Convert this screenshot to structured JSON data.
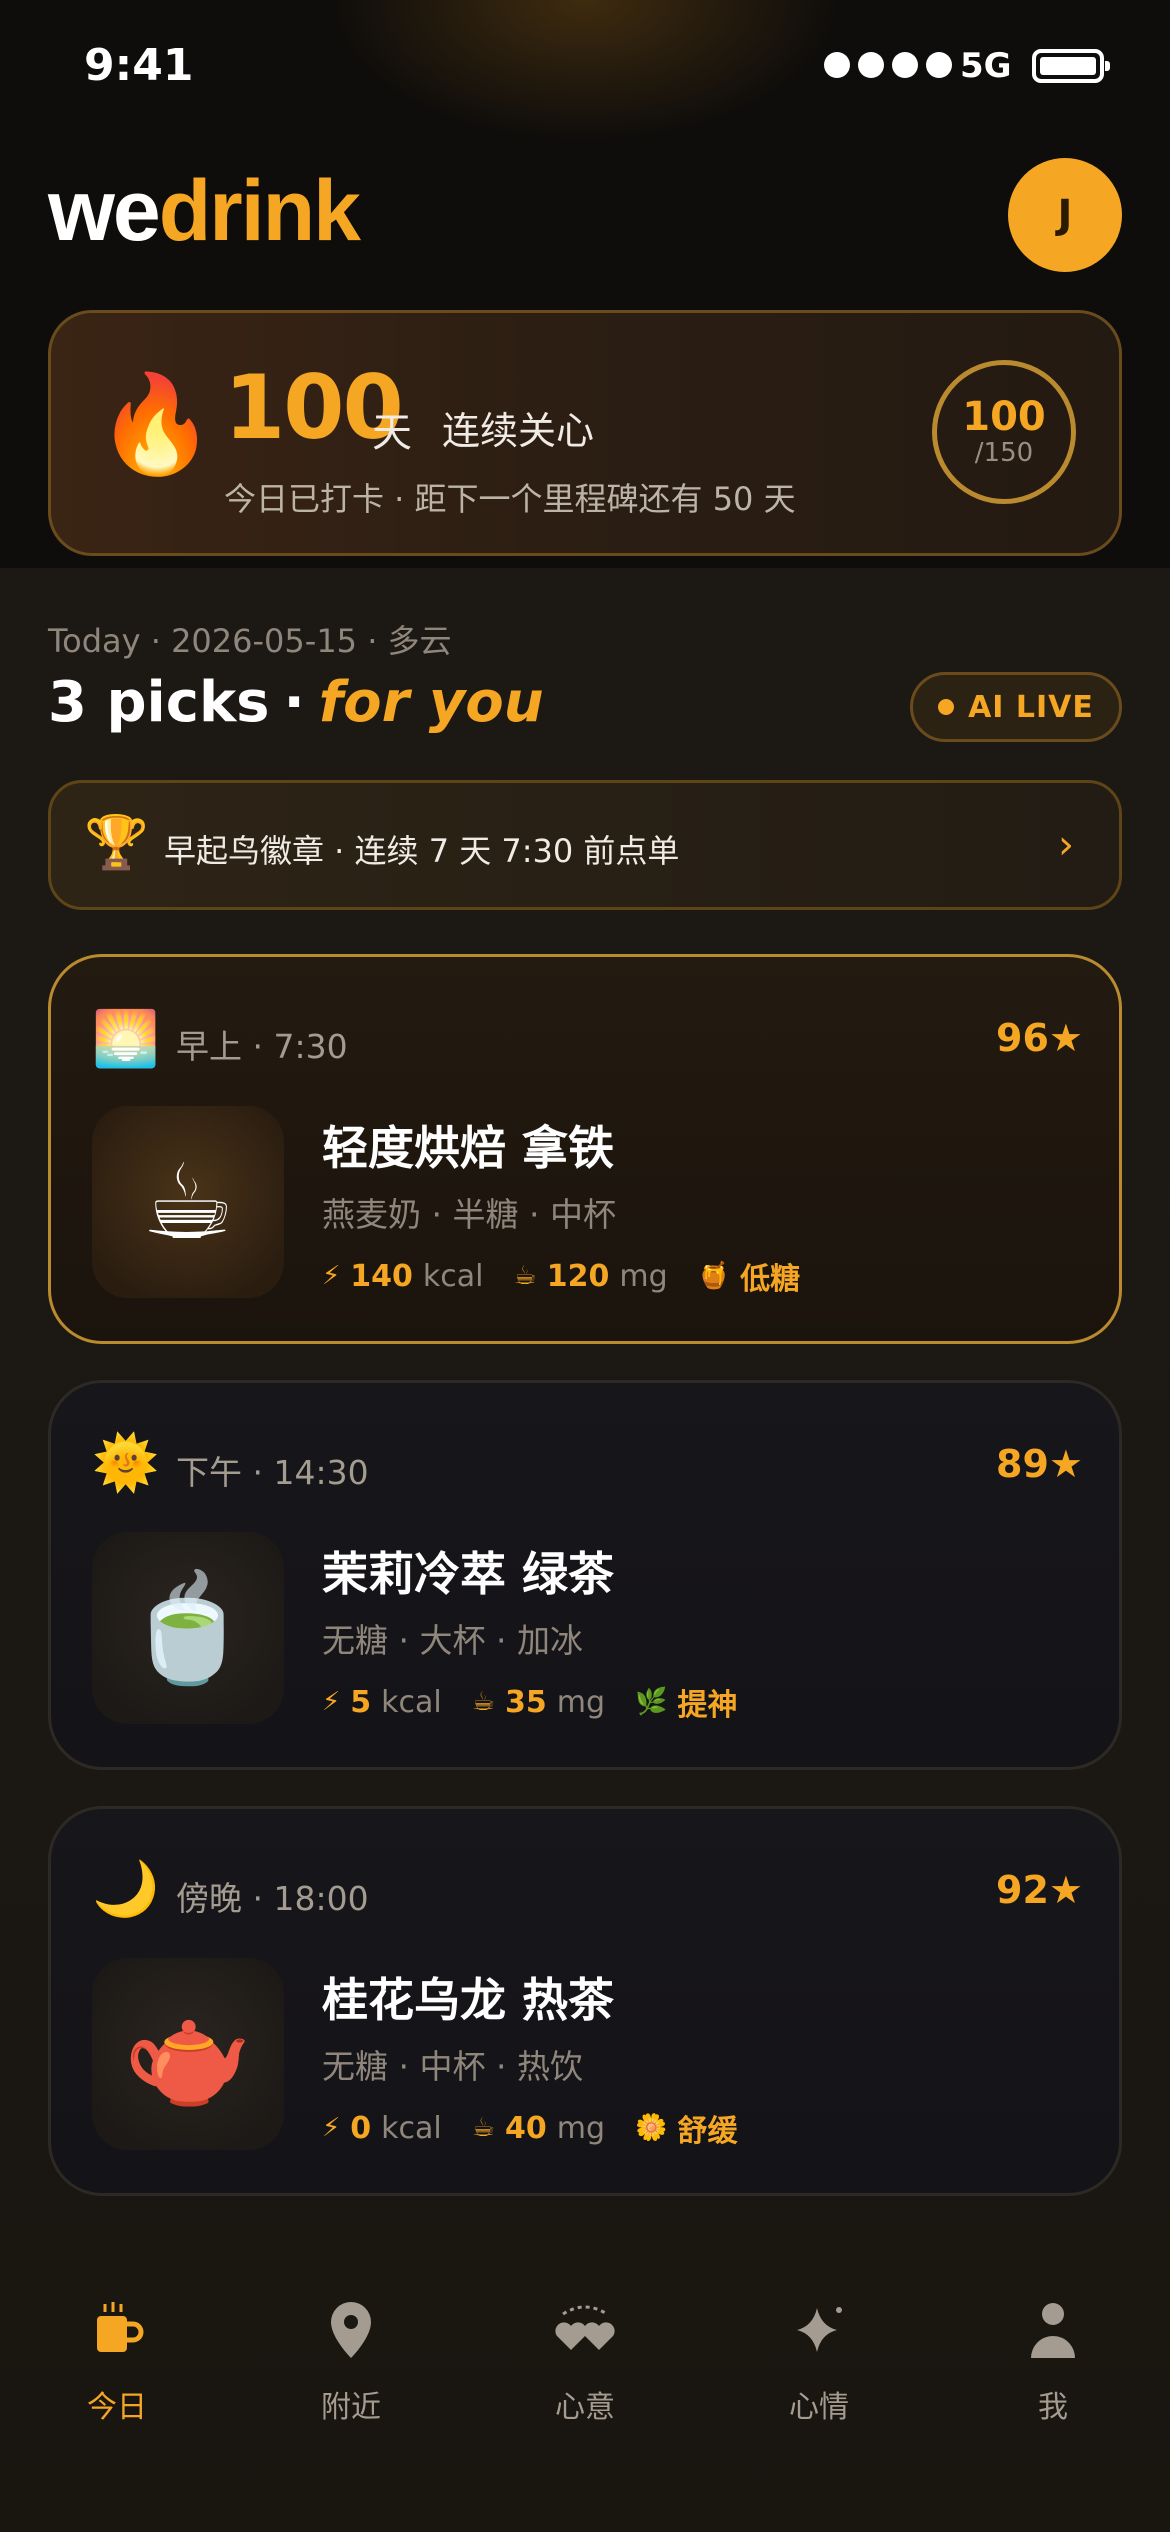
{
  "status_bar": {
    "time": "9:41",
    "network": "5G"
  },
  "header": {
    "logo_part1": "we",
    "logo_part2": "drink",
    "avatar_initial": "J"
  },
  "streak": {
    "count": "100",
    "unit": "天",
    "label": "连续关心",
    "subtitle": "今日已打卡 · 距下一个里程碑还有 50 天",
    "progress_current": "100",
    "progress_total": "/150",
    "progress_fraction": 0.667
  },
  "today_line": "Today · 2026-05-15 · 多云",
  "picks_title": {
    "count": "3 picks",
    "separator": "·",
    "accent": "for you"
  },
  "ai_badge": "AI LIVE",
  "badge_banner": {
    "text": "早起鸟徽章 · 连续 7 天 7:30 前点单"
  },
  "picks": [
    {
      "time_label": "早上 · 7:30",
      "score": "96★",
      "name": "轻度烘焙 拿铁",
      "desc": "燕麦奶 · 半糖 · 中杯",
      "kcal_value": "140",
      "kcal_unit": "kcal",
      "caffeine_value": "120",
      "caffeine_unit": "mg",
      "tag": "低糖",
      "icon": "sunrise-icon",
      "thumb": "latte-cup-icon"
    },
    {
      "time_label": "下午 · 14:30",
      "score": "89★",
      "name": "茉莉冷萃 绿茶",
      "desc": "无糖 · 大杯 · 加冰",
      "kcal_value": "5",
      "kcal_unit": "kcal",
      "caffeine_value": "35",
      "caffeine_unit": "mg",
      "tag": "提神",
      "icon": "sun-icon",
      "thumb": "green-tea-icon"
    },
    {
      "time_label": "傍晚 · 18:00",
      "score": "92★",
      "name": "桂花乌龙 热茶",
      "desc": "无糖 · 中杯 · 热饮",
      "kcal_value": "0",
      "kcal_unit": "kcal",
      "caffeine_value": "40",
      "caffeine_unit": "mg",
      "tag": "舒缓",
      "icon": "moon-icon",
      "thumb": "teapot-icon"
    }
  ],
  "tabs": [
    {
      "label": "今日"
    },
    {
      "label": "附近"
    },
    {
      "label": "心意"
    },
    {
      "label": "心情"
    },
    {
      "label": "我"
    }
  ],
  "colors": {
    "accent": "#f5a623",
    "background": "#1a1612"
  }
}
